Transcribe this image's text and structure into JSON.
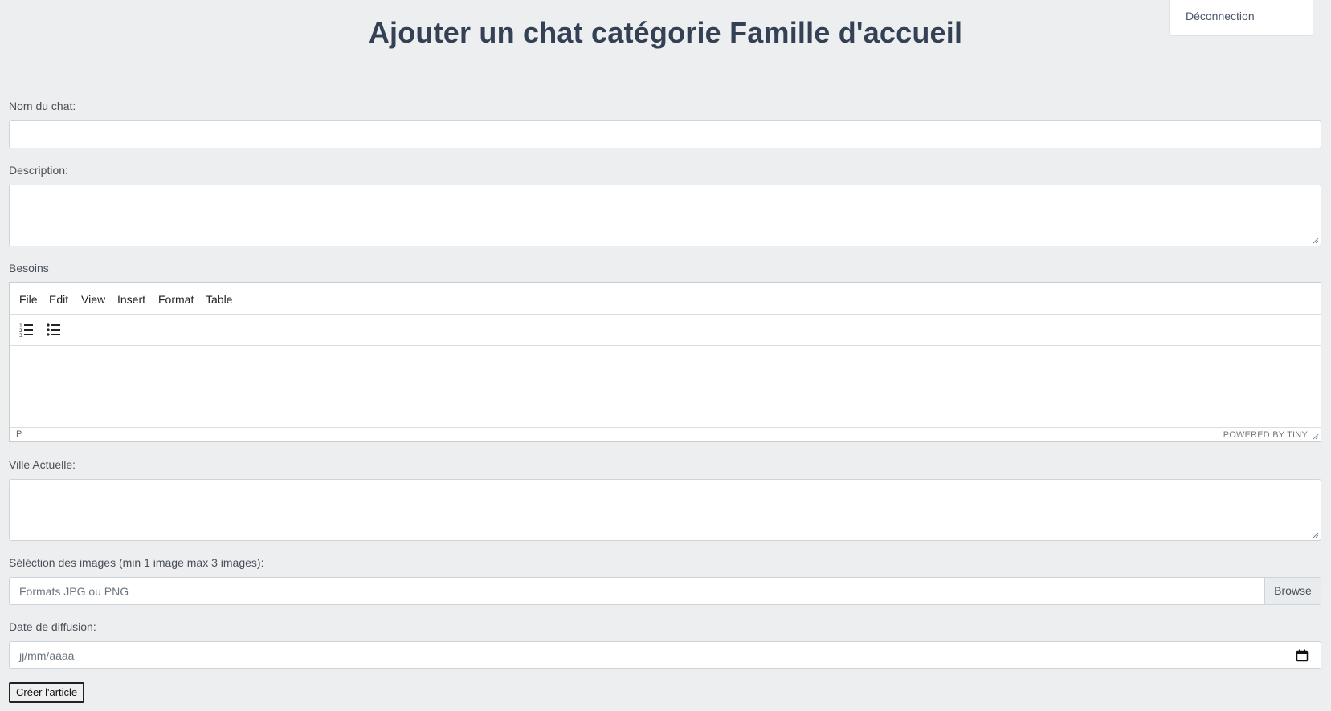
{
  "header": {
    "logout_label": "Déconnection",
    "title": "Ajouter un chat catégorie Famille d'accueil"
  },
  "form": {
    "name_label": "Nom du chat:",
    "name_value": "",
    "description_label": "Description:",
    "description_value": "",
    "besoins_label": "Besoins",
    "ville_label": "Ville Actuelle:",
    "ville_value": "",
    "images_label": "Séléction des images (min 1 image max 3 images):",
    "images_placeholder": "Formats JPG ou PNG",
    "browse_label": "Browse",
    "date_label": "Date de diffusion:",
    "date_placeholder": "jj/mm/aaaa",
    "submit_label": "Créer l'article"
  },
  "editor": {
    "menu": [
      "File",
      "Edit",
      "View",
      "Insert",
      "Format",
      "Table"
    ],
    "toolbar_icons": [
      "numbered-list-icon",
      "bullet-list-icon"
    ],
    "status_path": "P",
    "powered_by": "POWERED BY TINY"
  }
}
